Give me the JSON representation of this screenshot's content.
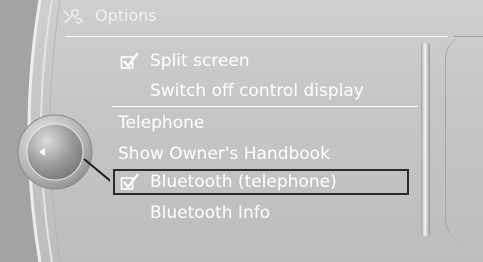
{
  "title": {
    "text": "Options",
    "icon": "options-tools-icon"
  },
  "menu": {
    "items": [
      {
        "label": "Split screen",
        "checked": true,
        "indent": true
      },
      {
        "label": "Switch off control display",
        "checked": false,
        "indent": true
      },
      {
        "label": "Telephone",
        "checked": false,
        "indent": false
      },
      {
        "label": "Show Owner's Handbook",
        "checked": false,
        "indent": false
      },
      {
        "label": "Bluetooth (telephone)",
        "checked": true,
        "indent": true,
        "selected": true
      },
      {
        "label": "Bluetooth Info",
        "checked": false,
        "indent": true
      }
    ]
  },
  "controller": {
    "icon": "back-arrow-icon"
  },
  "colors": {
    "text": "#ffffff",
    "background": "#c6c6c6",
    "highlight_border": "#2b2b2b"
  }
}
